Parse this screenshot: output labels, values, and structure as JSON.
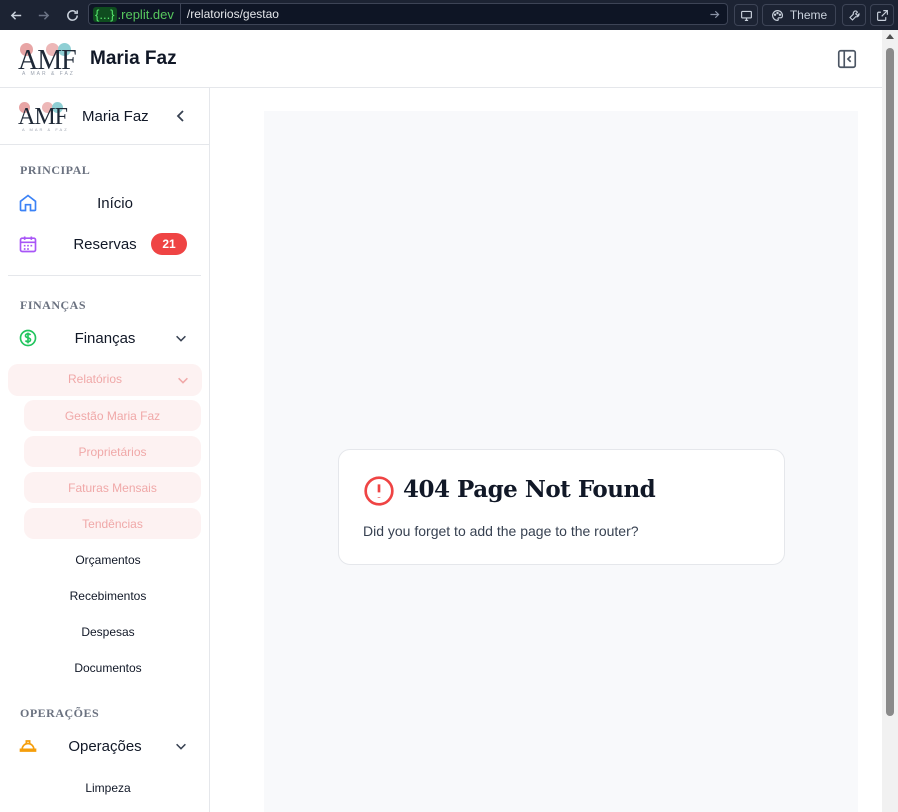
{
  "browser": {
    "url_domain_badge": "{...}",
    "url_domain": ".replit.dev",
    "url_path": "/relatorios/gestao",
    "theme_label": "Theme"
  },
  "header": {
    "logo_text": "AMF",
    "logo_subtitle": "A MAR & FAZ",
    "title": "Maria Faz"
  },
  "sidebar": {
    "brand_name": "Maria Faz",
    "sections": {
      "principal": "PRINCIPAL",
      "financas": "FINANÇAS",
      "operacoes": "OPERAÇÕES"
    },
    "items": {
      "inicio": "Início",
      "reservas": "Reservas",
      "reservas_count": "21",
      "financas": "Finanças",
      "relatorios": "Relatórios",
      "gestao": "Gestão Maria Faz",
      "proprietarios": "Proprietários",
      "faturas": "Faturas Mensais",
      "tendencias": "Tendências",
      "orcamentos": "Orçamentos",
      "recebimentos": "Recebimentos",
      "despesas": "Despesas",
      "documentos": "Documentos",
      "operacoes": "Operações",
      "limpeza": "Limpeza"
    }
  },
  "main": {
    "error_title": "404 Page Not Found",
    "error_message": "Did you forget to add the page to the router?"
  },
  "colors": {
    "accent_red": "#ef4444",
    "badge_red": "#ef4444",
    "submenu_pink": "#fdf2f2",
    "submenu_text": "#f0a8a8",
    "home_icon": "#3b82f6",
    "calendar_icon": "#a855f7",
    "dollar_icon": "#22c55e",
    "helmet_icon": "#f59e0b"
  },
  "icons": [
    "back-arrow-icon",
    "forward-arrow-icon",
    "reload-icon",
    "monitor-icon",
    "palette-icon",
    "wrench-icon",
    "external-link-icon",
    "sidebar-collapse-icon",
    "chevron-left-icon",
    "home-icon",
    "calendar-icon",
    "dollar-circle-icon",
    "chevron-down-icon",
    "helmet-icon",
    "alert-circle-icon"
  ]
}
